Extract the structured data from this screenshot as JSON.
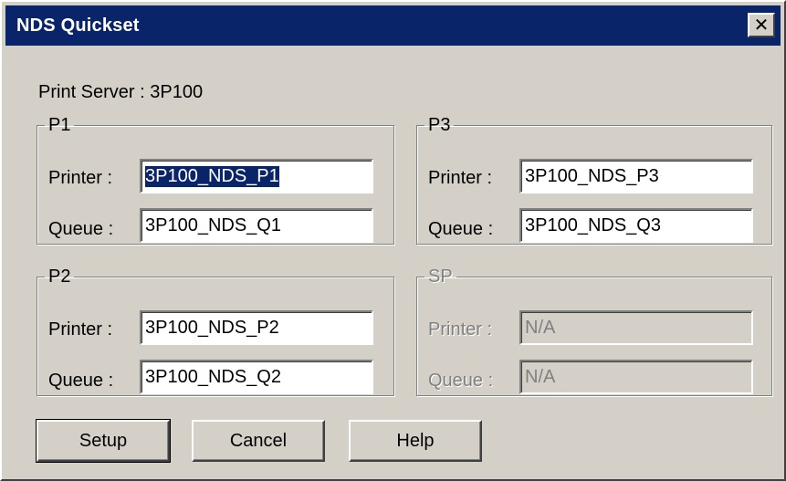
{
  "window": {
    "title": "NDS Quickset",
    "close_glyph": "✕"
  },
  "print_server": {
    "label": "Print Server : 3P100"
  },
  "groups": {
    "p1": {
      "legend": "P1",
      "printer_label": "Printer :",
      "printer_value": "3P100_NDS_P1",
      "queue_label": "Queue :",
      "queue_value": "3P100_NDS_Q1"
    },
    "p2": {
      "legend": "P2",
      "printer_label": "Printer :",
      "printer_value": "3P100_NDS_P2",
      "queue_label": "Queue :",
      "queue_value": "3P100_NDS_Q2"
    },
    "p3": {
      "legend": "P3",
      "printer_label": "Printer :",
      "printer_value": "3P100_NDS_P3",
      "queue_label": "Queue :",
      "queue_value": "3P100_NDS_Q3"
    },
    "sp": {
      "legend": "SP",
      "printer_label": "Printer :",
      "printer_value": "N/A",
      "queue_label": "Queue :",
      "queue_value": "N/A"
    }
  },
  "buttons": {
    "setup": "Setup",
    "cancel": "Cancel",
    "help": "Help"
  },
  "colors": {
    "titlebar": "#0a246a",
    "face": "#d4d0c8",
    "selection": "#0a246a"
  },
  "icons": {
    "close": "close-icon"
  }
}
